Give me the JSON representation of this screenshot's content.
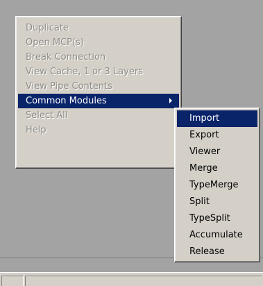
{
  "context_menu": {
    "items": [
      {
        "label": "Duplicate",
        "state": "disabled"
      },
      {
        "label": "Open MCP(s)",
        "state": "disabled"
      },
      {
        "label": "Break Connection",
        "state": "disabled"
      },
      {
        "label": "View Cache, 1 or 3 Layers",
        "state": "disabled"
      },
      {
        "label": "View Pipe Contents",
        "state": "disabled"
      },
      {
        "label": "Common Modules",
        "state": "highlighted",
        "has_submenu": true
      },
      {
        "label": "Select All",
        "state": "disabled"
      },
      {
        "label": "Help",
        "state": "disabled"
      }
    ]
  },
  "submenu": {
    "items": [
      {
        "label": "Import",
        "state": "highlighted"
      },
      {
        "label": "Export",
        "state": "enabled"
      },
      {
        "label": "Viewer",
        "state": "enabled"
      },
      {
        "label": "Merge",
        "state": "enabled"
      },
      {
        "label": "TypeMerge",
        "state": "enabled"
      },
      {
        "label": "Split",
        "state": "enabled"
      },
      {
        "label": "TypeSplit",
        "state": "enabled"
      },
      {
        "label": "Accumulate",
        "state": "enabled"
      },
      {
        "label": "Release",
        "state": "enabled"
      }
    ]
  },
  "colors": {
    "highlight": "#0a246a",
    "menu_background": "#d4d0c8",
    "workspace_background": "#a3a3a3",
    "disabled_text": "#8e8c86"
  }
}
